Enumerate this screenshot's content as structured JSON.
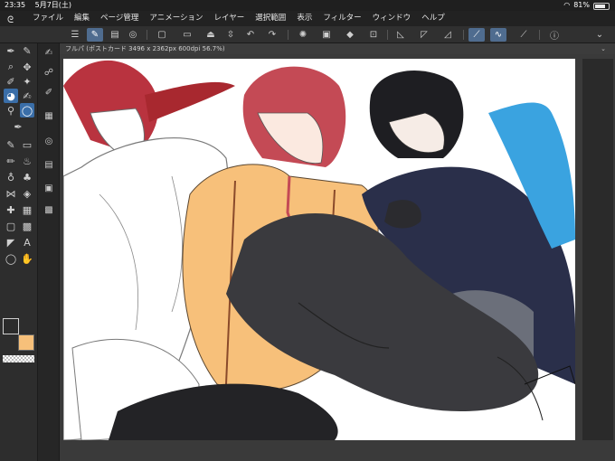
{
  "status": {
    "time": "23:35",
    "date": "5月7日(土)",
    "battery": "81%",
    "battery_level": 0.81
  },
  "menu": {
    "items": [
      "ファイル",
      "編集",
      "ページ管理",
      "アニメーション",
      "レイヤー",
      "選択範囲",
      "表示",
      "フィルター",
      "ウィンドウ",
      "ヘルプ"
    ]
  },
  "document": {
    "tab_label": "フルパ (ポストカード 3496 x 2362px 600dpi 56.7%)"
  },
  "colors": {
    "main": "#2b2b2b",
    "sub": "#f7c07a",
    "accent": "#4f6c8f"
  }
}
